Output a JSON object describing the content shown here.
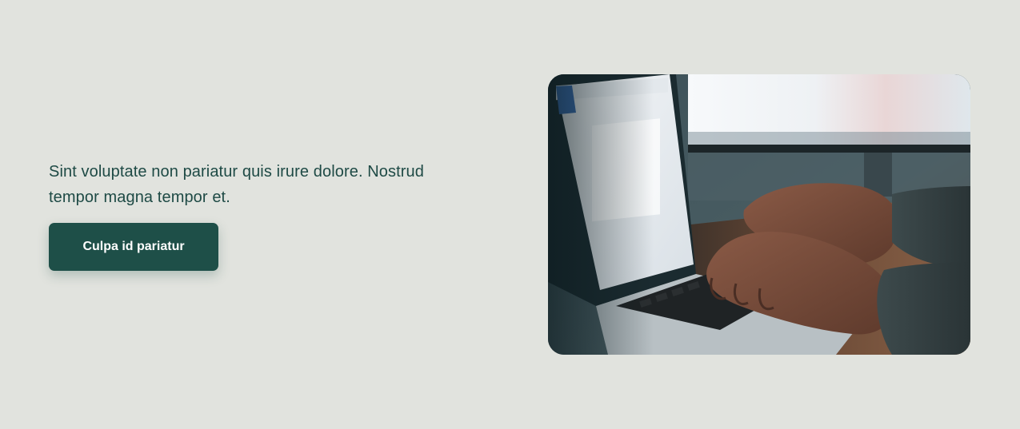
{
  "hero": {
    "text": "Sint voluptate non pariatur quis irure dolore. Nostrud tempor magna tempor et.",
    "button_label": "Culpa id pariatur",
    "image_subject": "hands-typing-on-laptop-photo"
  },
  "colors": {
    "background": "#e1e3de",
    "text": "#1e4a45",
    "button": "#1e4f48",
    "button_text": "#ffffff"
  }
}
